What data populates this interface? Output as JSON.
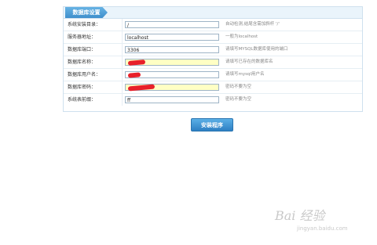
{
  "panel": {
    "title": "数据库设置"
  },
  "rows": [
    {
      "label": "系统安装目录：",
      "value": "/",
      "hint": "自动检测,结尾含需加斜杆 '/'",
      "highlight": false
    },
    {
      "label": "服务器地址：",
      "value": "localhost",
      "hint": "一般为localhost",
      "highlight": false
    },
    {
      "label": "数据库端口：",
      "value": "3306",
      "hint": "请填写MYSQL数据库使用的端口",
      "highlight": false
    },
    {
      "label": "数据库名称：",
      "value": "",
      "hint": "请填写已存在的数据库名",
      "highlight": true
    },
    {
      "label": "数据库用户名：",
      "value": "",
      "hint": "请填写mysql用户名",
      "highlight": false
    },
    {
      "label": "数据库密码：",
      "value": "",
      "hint": "密码不要为空",
      "highlight": true
    },
    {
      "label": "系统表前缀：",
      "value": "ff_",
      "hint": "密码不要为空",
      "highlight": false
    }
  ],
  "install_button": {
    "label": "安装程序"
  },
  "watermark": {
    "logo": "Bai 经验",
    "url": "jingyan.baidu.com"
  },
  "colors": {
    "accent": "#3f8fcc",
    "redact": "#e8202a",
    "highlight_field": "#ffffc4"
  }
}
